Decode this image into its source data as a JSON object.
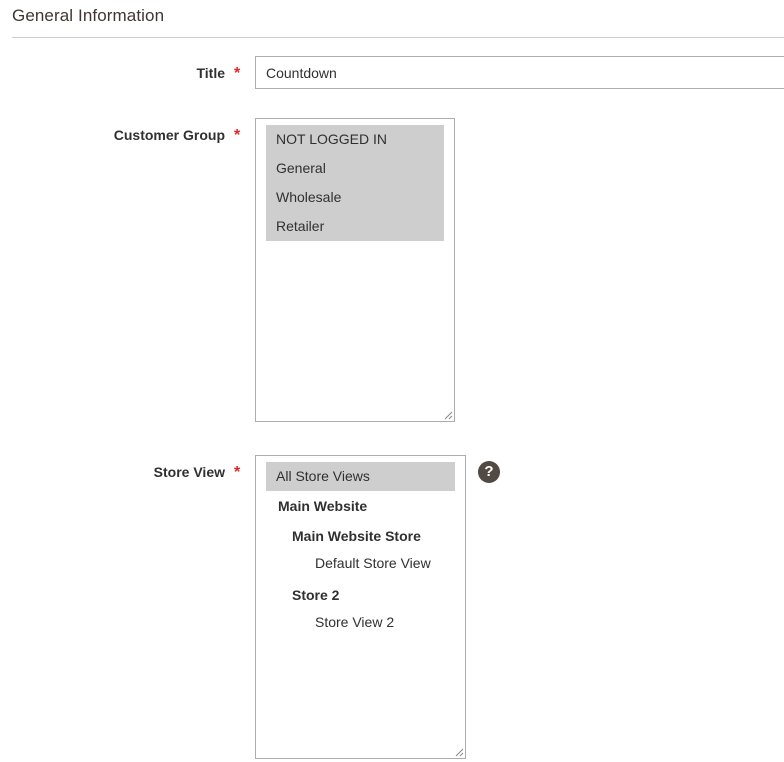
{
  "section": {
    "title": "General Information"
  },
  "fields": {
    "title": {
      "label": "Title",
      "value": "Countdown",
      "required_mark": "*"
    },
    "customer_group": {
      "label": "Customer Group",
      "required_mark": "*",
      "options": [
        "NOT LOGGED IN",
        "General",
        "Wholesale",
        "Retailer"
      ]
    },
    "store_view": {
      "label": "Store View",
      "required_mark": "*",
      "all": "All Store Views",
      "website": "Main Website",
      "store1": "Main Website Store",
      "view1": "Default Store View",
      "store2": "Store 2",
      "view2": "Store View 2",
      "help_icon": "?"
    }
  },
  "colors": {
    "required": "#e22626",
    "selected_bg": "#cecece",
    "help_bg": "#514943"
  }
}
